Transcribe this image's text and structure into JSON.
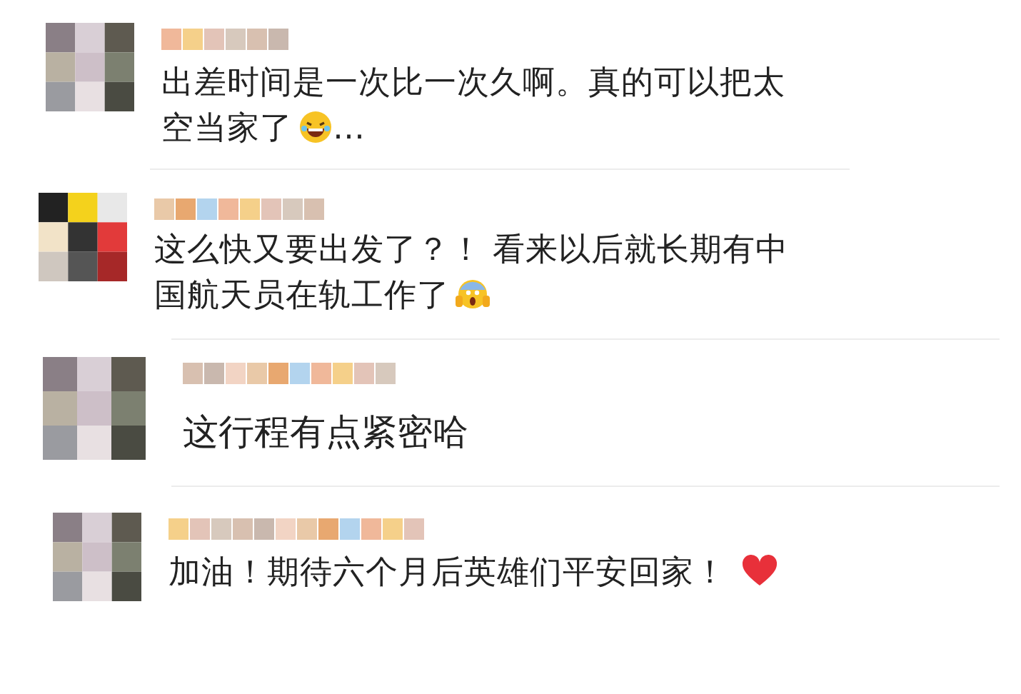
{
  "comments": [
    {
      "text": "出差时间是一次比一次久啊。真的可以把太空当家了",
      "kind": "laughing",
      "suffix": "…"
    },
    {
      "text": "这么快又要出发了？！ 看来以后就长期有中国航天员在轨工作了",
      "kind": "screaming"
    },
    {
      "text": "这行程有点紧密哈",
      "kind": "plain"
    },
    {
      "text": "加油！期待六个月后英雄们平安回家！",
      "kind": "heart"
    }
  ]
}
